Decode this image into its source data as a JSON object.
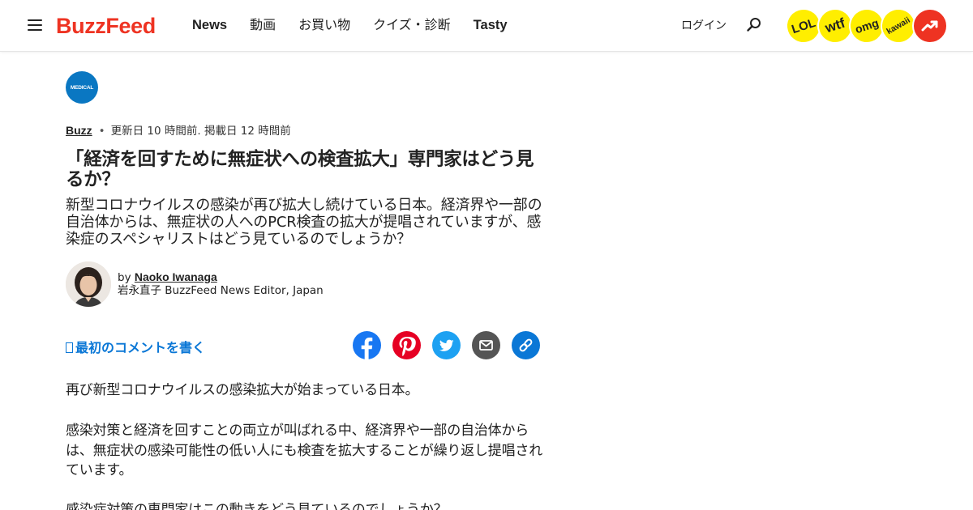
{
  "header": {
    "logo": "BuzzFeed",
    "nav": [
      {
        "label": "News"
      },
      {
        "label": "動画"
      },
      {
        "label": "お買い物"
      },
      {
        "label": "クイズ・診断"
      },
      {
        "label": "Tasty"
      }
    ],
    "login": "ログイン",
    "badges": [
      {
        "label": "LOL"
      },
      {
        "label": "wtf"
      },
      {
        "label": "omg"
      },
      {
        "label": "kawaii"
      }
    ],
    "icons": {
      "menu": "hamburger-menu-icon",
      "search": "search-icon",
      "trending": "trending-arrow-icon"
    },
    "colors": {
      "brand": "#ee3322",
      "badge": "#ffee00",
      "link": "#0a77d6"
    }
  },
  "article": {
    "category_badge": "MEDICAL",
    "category": "Buzz",
    "timestamp": "更新日 10 時間前. 掲載日 12 時間前",
    "title": "「経済を回すために無症状への検査拡大」専門家はどう見るか？",
    "description": "新型コロナウイルスの感染が再び拡大し続けている日本。経済界や一部の自治体からは、無症状の人へのPCR検査の拡大が提唱されていますが、感染症のスペシャリストはどう見ているのでしょうか？",
    "author": {
      "by": "by",
      "name": "Naoko Iwanaga",
      "role": "岩永直子 BuzzFeed News Editor, Japan"
    },
    "comment_link": "最初のコメントを書く",
    "share": [
      {
        "network": "facebook",
        "icon": "facebook-icon",
        "color": "#1877f2"
      },
      {
        "network": "pinterest",
        "icon": "pinterest-icon",
        "color": "#e60023"
      },
      {
        "network": "twitter",
        "icon": "twitter-icon",
        "color": "#1da1f2"
      },
      {
        "network": "email",
        "icon": "mail-icon",
        "color": "#555555"
      },
      {
        "network": "link",
        "icon": "link-icon",
        "color": "#0a77d6"
      }
    ],
    "paragraphs": [
      "再び新型コロナウイルスの感染拡大が始まっている日本。",
      "感染対策と経済を回すことの両立が叫ばれる中、経済界や一部の自治体からは、無症状の感染可能性の低い人にも検査を拡大することが繰り返し提唱されています。",
      "感染症対策の専門家はこの動きをどう見ているのでしょうか？"
    ]
  }
}
